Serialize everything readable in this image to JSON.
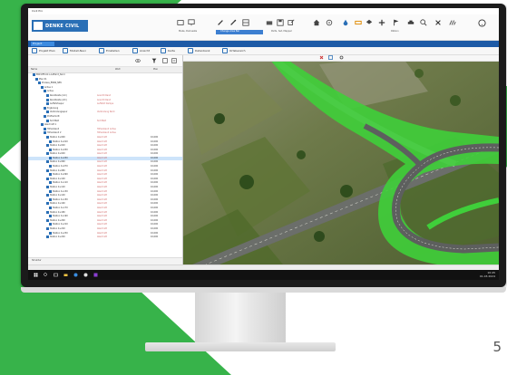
{
  "page": {
    "number": "5"
  },
  "colors": {
    "accent_green": "#37b34a",
    "brand_blue": "#2a6fb6",
    "ribbon_selected": "#3d7fd1",
    "road_green": "#3fcf3a"
  },
  "app": {
    "title": "Civil Pro",
    "logo_text": "DENKE CIVIL",
    "ribbon_labels": [
      "Make, Delineate",
      "Change Area Bar",
      "Parts, Set, Mapper",
      "Ribbon"
    ],
    "nav_tab": "Project",
    "subtabs": [
      "Projekt Plan",
      "Modell-Navi",
      "Einstellen",
      "Ansicht",
      "Karte",
      "Datenbank",
      "Ortsbereich"
    ]
  },
  "panel": {
    "col_headers": [
      "Name",
      "Wert",
      "Plan"
    ],
    "rows": [
      {
        "label": "ERP-RFE-011 Auffahrt_Nord",
        "c2": "",
        "c3": ""
      },
      {
        "label": "Plan 01",
        "c2": "",
        "c3": ""
      },
      {
        "label": "Prozess_ENNS_NEU",
        "c2": "",
        "c3": ""
      },
      {
        "label": "Achse 1",
        "c2": "",
        "c3": ""
      },
      {
        "label": "Achse",
        "c2": "",
        "c3": ""
      },
      {
        "label": "Randbreite (1m)",
        "c2": "Ansicht Rand",
        "c3": ""
      },
      {
        "label": "Randbreite (2m)",
        "c2": "Ansicht Rand",
        "c3": ""
      },
      {
        "label": "Auffahrtsspur",
        "c2": "Auffahrt Rampe",
        "c3": ""
      },
      {
        "label": "Ergänzung",
        "c2": "",
        "c3": ""
      },
      {
        "label": "Verbindungsspur",
        "c2": "Verbindung Nord",
        "c3": ""
      },
      {
        "label": "Profilschnitt",
        "c2": "",
        "c3": ""
      },
      {
        "label": "Sichtfeld",
        "c2": "Sichtfeld",
        "c3": ""
      },
      {
        "label": "Abschnitt 1",
        "c2": "",
        "c3": ""
      },
      {
        "label": "Höhenband",
        "c2": "Höhenband Achse",
        "c3": ""
      },
      {
        "label": "Höhenband 2",
        "c2": "Höhenband Achse",
        "c3": ""
      },
      {
        "label": "Station 0+000",
        "c2": "Abschnitt",
        "c3": "10,000"
      },
      {
        "label": "Station 0+010",
        "c2": "Abschnitt",
        "c3": "10,000"
      },
      {
        "label": "Station 0+020",
        "c2": "Abschnitt",
        "c3": "10,000"
      },
      {
        "label": "Station 0+030",
        "c2": "Abschnitt",
        "c3": "10,000"
      },
      {
        "label": "Station 0+040",
        "c2": "Abschnitt",
        "c3": "10,000"
      },
      {
        "label": "Station 0+050",
        "c2": "Abschnitt",
        "c3": "10,000"
      },
      {
        "label": "Station 0+060",
        "c2": "Abschnitt",
        "c3": "10,000"
      },
      {
        "label": "Station 0+070",
        "c2": "Abschnitt",
        "c3": "10,000"
      },
      {
        "label": "Station 0+080",
        "c2": "Abschnitt",
        "c3": "10,000"
      },
      {
        "label": "Station 0+090",
        "c2": "Abschnitt",
        "c3": "10,000"
      },
      {
        "label": "Station 0+100",
        "c2": "Abschnitt",
        "c3": "10,000"
      },
      {
        "label": "Station 0+110",
        "c2": "Abschnitt",
        "c3": "10,000"
      },
      {
        "label": "Station 0+120",
        "c2": "Abschnitt",
        "c3": "10,000"
      },
      {
        "label": "Station 0+130",
        "c2": "Abschnitt",
        "c3": "10,000"
      },
      {
        "label": "Station 0+140",
        "c2": "Abschnitt",
        "c3": "10,000"
      },
      {
        "label": "Station 0+150",
        "c2": "Abschnitt",
        "c3": "10,000"
      },
      {
        "label": "Station 0+160",
        "c2": "Abschnitt",
        "c3": "10,000"
      },
      {
        "label": "Station 0+170",
        "c2": "Abschnitt",
        "c3": "10,000"
      },
      {
        "label": "Station 0+180",
        "c2": "Abschnitt",
        "c3": "10,000"
      },
      {
        "label": "Station 0+190",
        "c2": "Abschnitt",
        "c3": "10,000"
      },
      {
        "label": "Station 0+200",
        "c2": "Abschnitt",
        "c3": "10,000"
      },
      {
        "label": "Station 0+210",
        "c2": "Abschnitt",
        "c3": "10,000"
      },
      {
        "label": "Station 0+220",
        "c2": "Abschnitt",
        "c3": "10,000"
      },
      {
        "label": "Station 0+230",
        "c2": "Abschnitt",
        "c3": "10,000"
      },
      {
        "label": "Station 0+240",
        "c2": "Abschnitt",
        "c3": "10,000"
      }
    ],
    "selected_index": 20,
    "status_text": "Struktur"
  },
  "taskbar": {
    "time": "10:45",
    "date": "01.03.2024"
  }
}
